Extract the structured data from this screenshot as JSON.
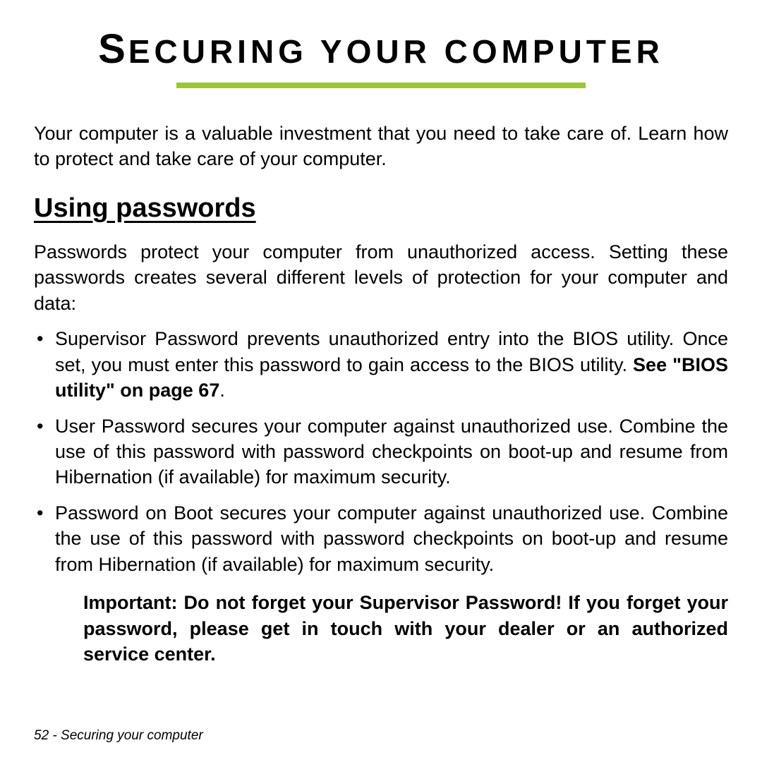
{
  "title_parts": {
    "s1_big": "S",
    "s1_rest": "ECURING",
    "sp": " ",
    "s2_rest": "YOUR",
    "sp2": " ",
    "s3_rest": "COMPUTER"
  },
  "intro": "Your computer is a valuable investment that you need to take care of. Learn how to protect and take care of your computer.",
  "section": {
    "heading": "Using passwords",
    "para": "Passwords protect your computer from unauthorized access. Setting these passwords creates several different levels of protection for your computer and data:",
    "items": [
      {
        "pre": "Supervisor Password prevents unauthorized entry into the BIOS utility. Once set, you must enter this password to gain access to the BIOS utility. ",
        "bold": "See \"BIOS utility\" on page 67",
        "post": "."
      },
      {
        "pre": "User Password secures your computer against unauthorized use. Combine the use of this password with password checkpoints on boot-up and resume from Hibernation (if available) for maximum security.",
        "bold": "",
        "post": ""
      },
      {
        "pre": "Password on Boot secures your computer against unauthorized use. Combine the use of this password with password checkpoints on boot-up and resume from Hibernation (if available) for maximum security.",
        "bold": "",
        "post": ""
      }
    ],
    "important": "Important: Do not forget your Supervisor Password! If you forget your password, please get in touch with your dealer or an authorized service center."
  },
  "footer": "52 - Securing your computer"
}
